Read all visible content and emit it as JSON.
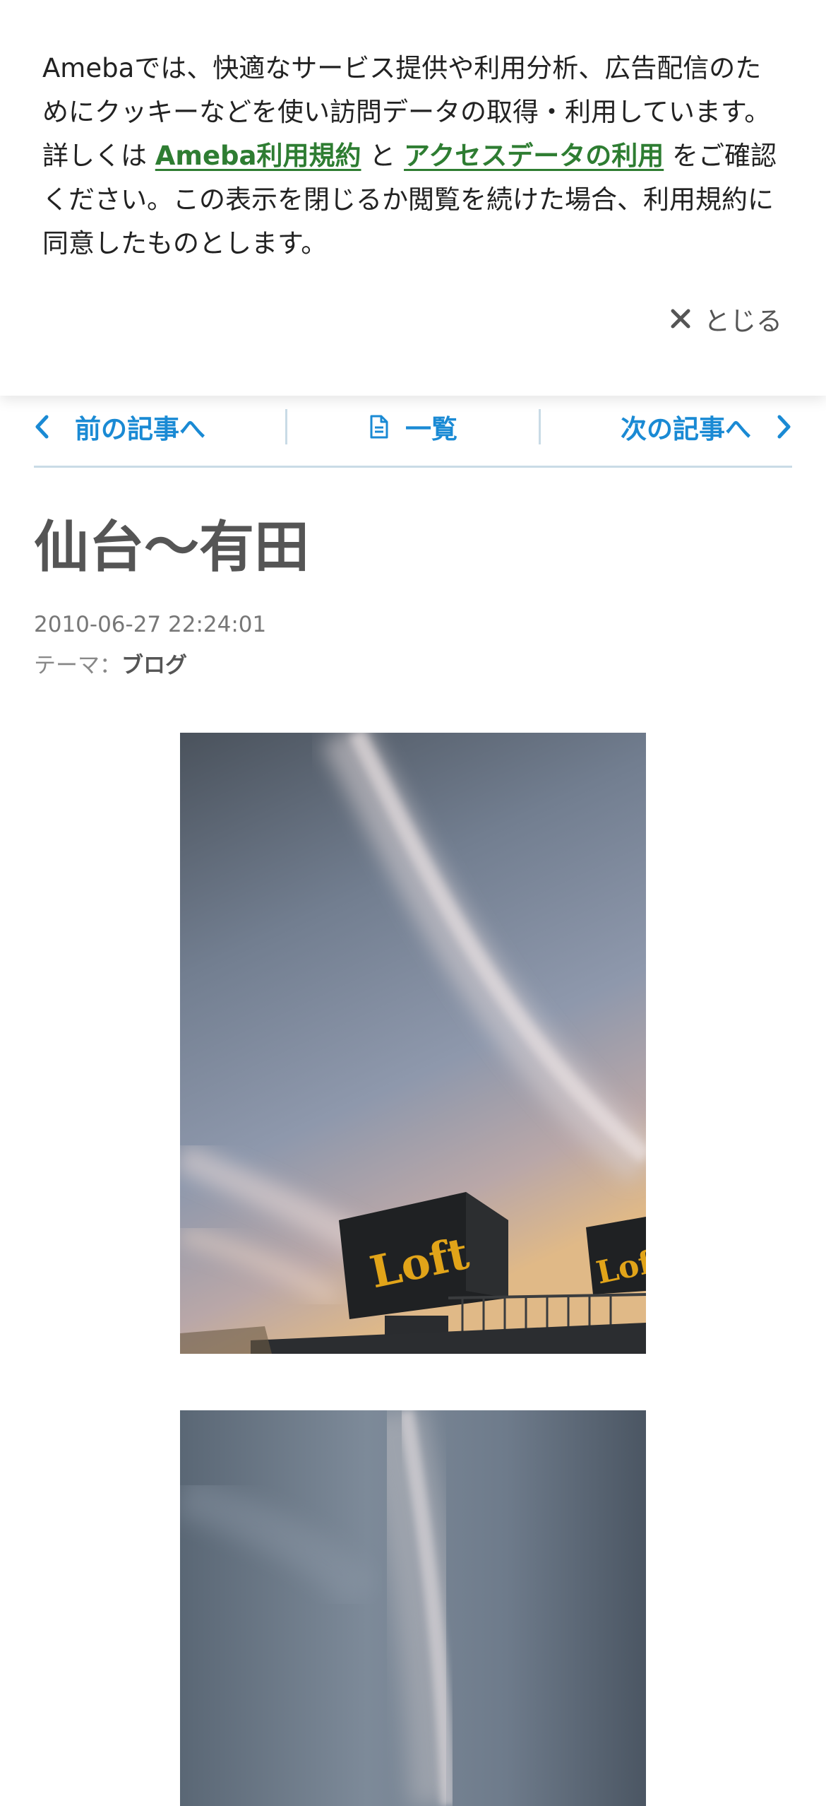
{
  "cookie_banner": {
    "text_1": "Amebaでは、快適なサービス提供や利用分析、広告配信のためにクッキーなどを使い訪問データの取得・利用しています。詳しくは ",
    "link_terms": "Ameba利用規約",
    "text_and": " と ",
    "link_access": "アクセスデータの利用",
    "text_2": " をご確認ください。この表示を閉じるか閲覧を続けた場合、利用規約に同意したものとします。",
    "close_label": "とじる"
  },
  "article_nav": {
    "prev_label": "前の記事へ",
    "list_label": "一覧",
    "next_label": "次の記事へ"
  },
  "article": {
    "title": "仙台〜有田",
    "date": "2010-06-27 22:24:01",
    "theme_label": "テーマ：",
    "theme_value": "ブログ"
  },
  "photos": [
    {
      "sign_text": "Loft"
    },
    {}
  ],
  "colors": {
    "accent": "#1a8ad4",
    "link_green": "#2e7d32",
    "divider": "#c9dbe6"
  }
}
